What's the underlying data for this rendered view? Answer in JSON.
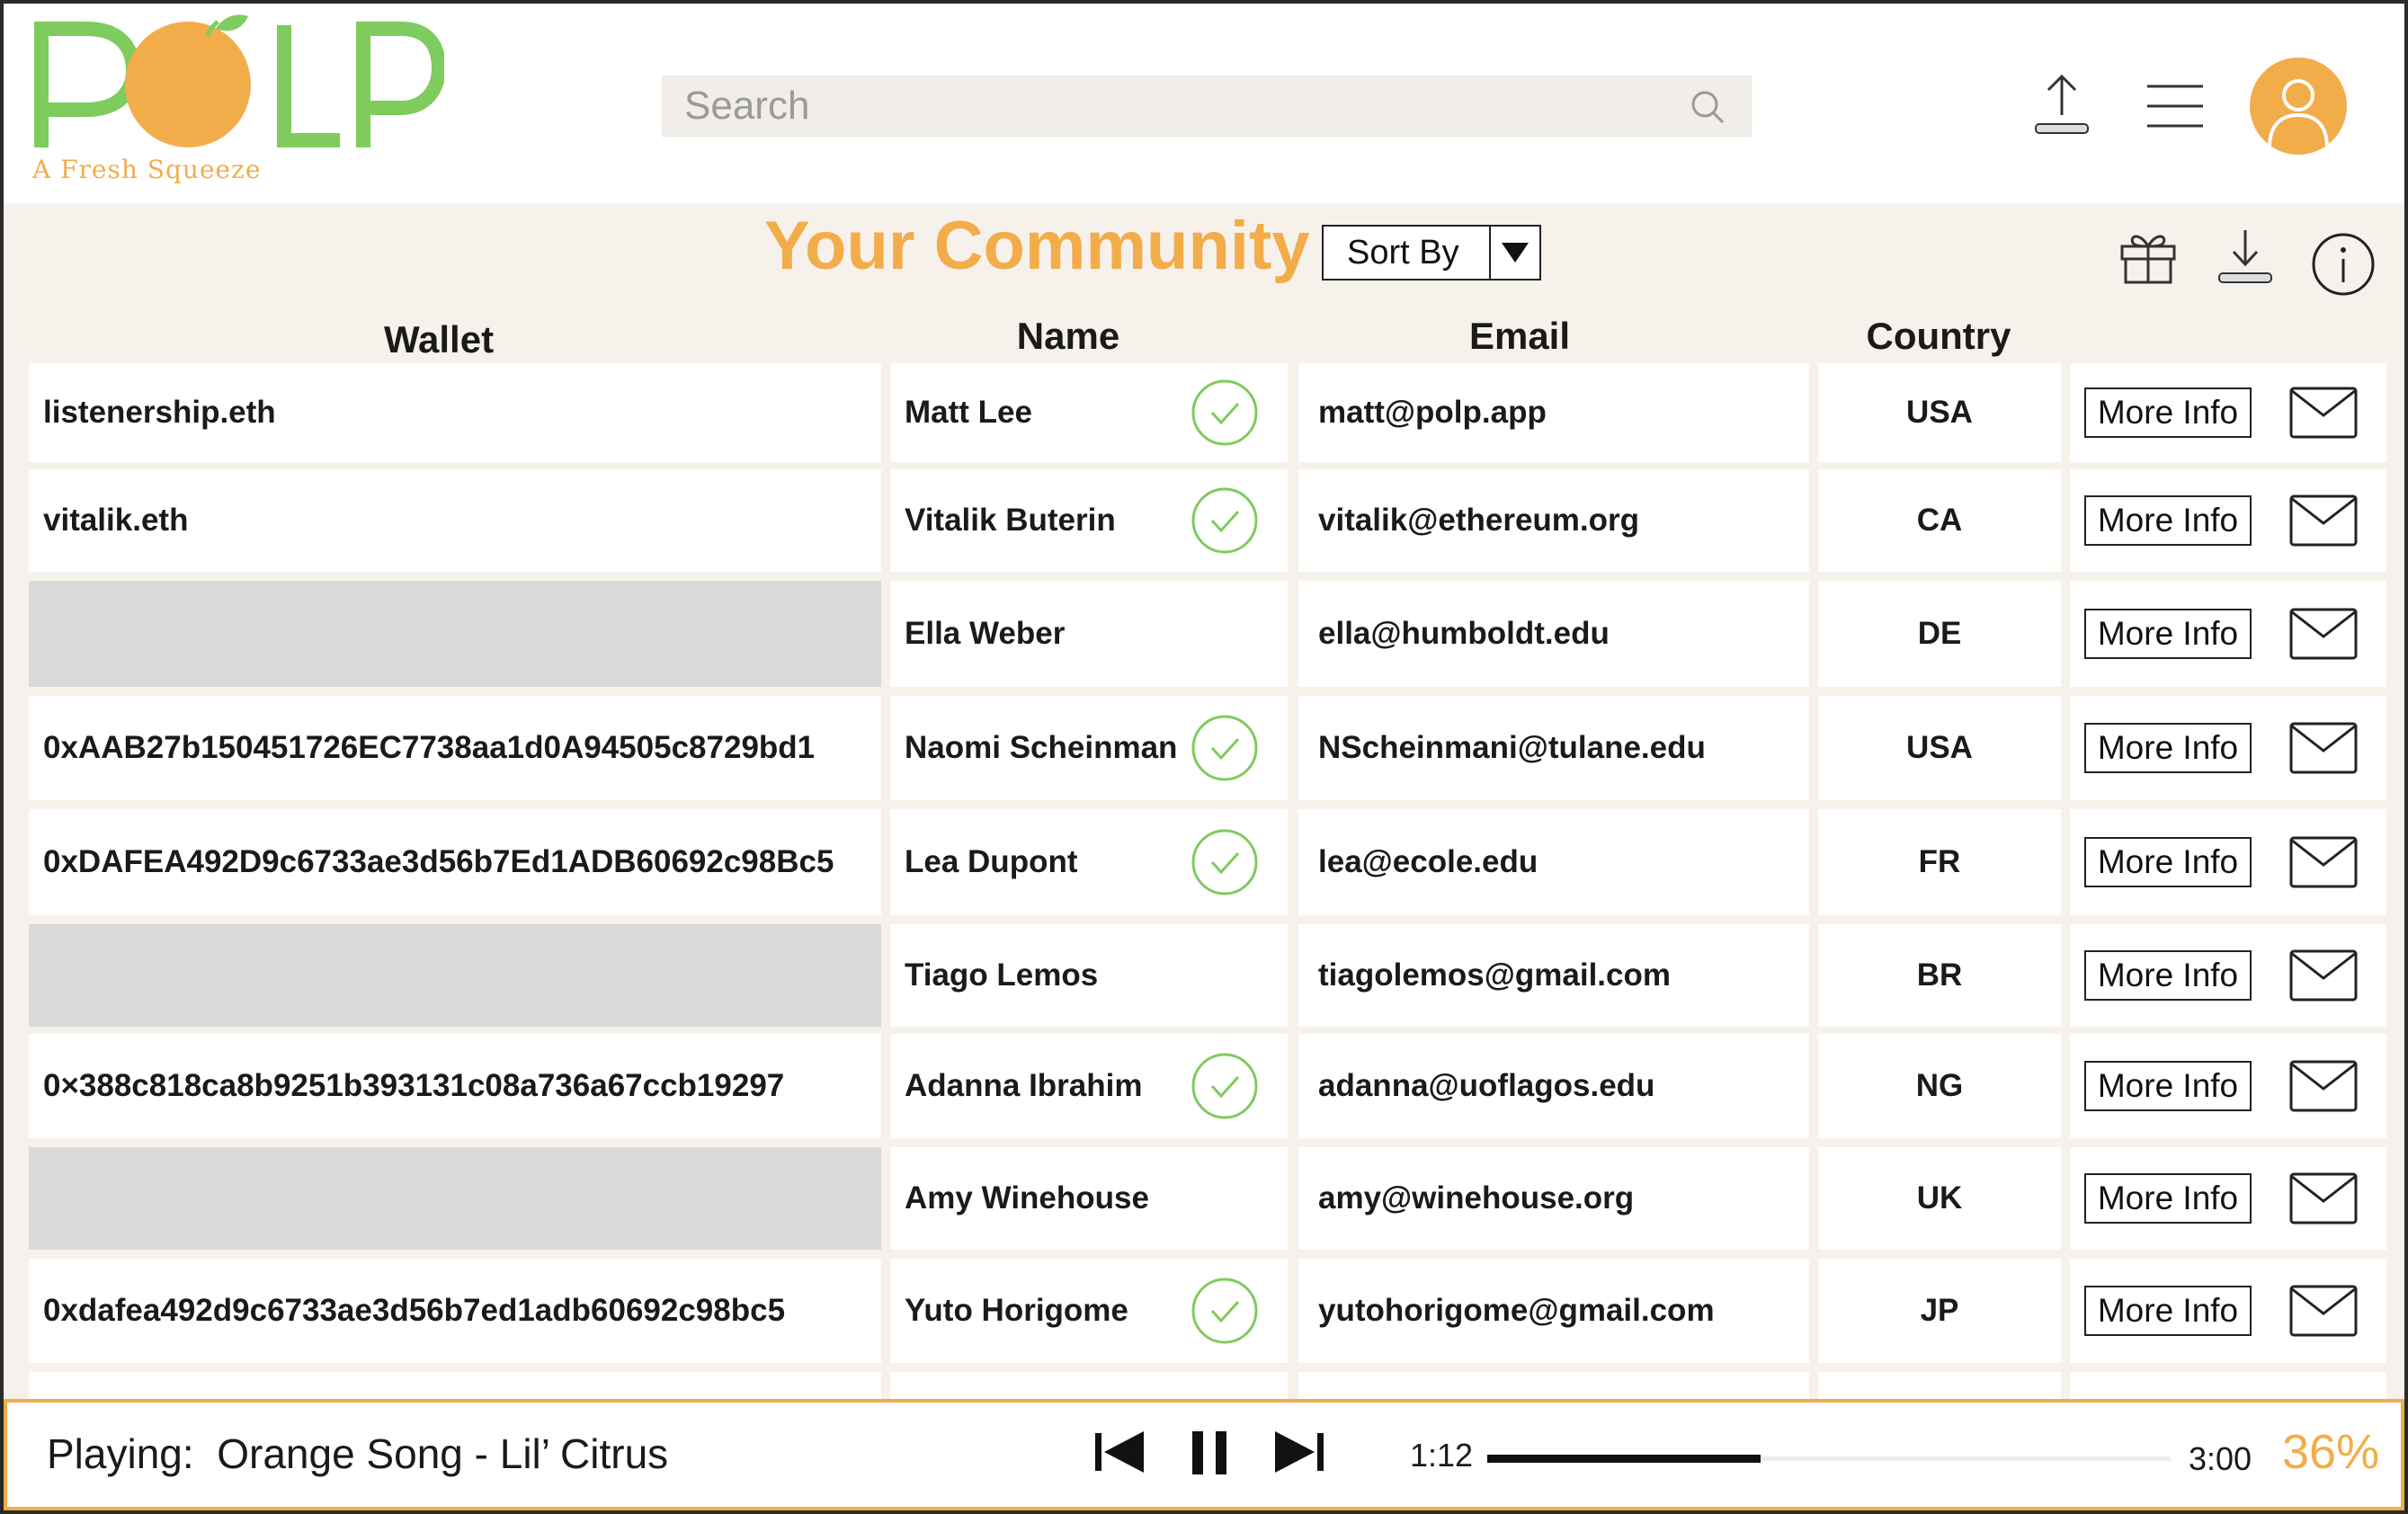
{
  "brand": {
    "name": "POLP",
    "tagline": "A Fresh Squeeze",
    "colors": {
      "orange": "#f2ad4a",
      "green": "#7ecb5e"
    }
  },
  "search": {
    "placeholder": "Search"
  },
  "header_icons": [
    "upload-icon",
    "hamburger-menu-icon",
    "user-avatar-icon"
  ],
  "community": {
    "title": "Your Community",
    "sort_label": "Sort By",
    "toolbar_icons": [
      "gift-icon",
      "download-icon",
      "info-icon"
    ]
  },
  "columns": {
    "wallet": "Wallet",
    "name": "Name",
    "email": "Email",
    "country": "Country"
  },
  "more_info_label": "More Info",
  "members": [
    {
      "wallet": "listenership.eth",
      "name": "Matt Lee",
      "verified": true,
      "email": "matt@polp.app",
      "country": "USA"
    },
    {
      "wallet": "vitalik.eth",
      "name": "Vitalik Buterin",
      "verified": true,
      "email": "vitalik@ethereum.org",
      "country": "CA"
    },
    {
      "wallet": "",
      "name": "Ella Weber",
      "verified": false,
      "email": "ella@humboldt.edu",
      "country": "DE"
    },
    {
      "wallet": "0xAAB27b150451726EC7738aa1d0A94505c8729bd1",
      "name": "Naomi Scheinman",
      "verified": true,
      "email": "NScheinmani@tulane.edu",
      "country": "USA"
    },
    {
      "wallet": "0xDAFEA492D9c6733ae3d56b7Ed1ADB60692c98Bc5",
      "name": "Lea Dupont",
      "verified": true,
      "email": "lea@ecole.edu",
      "country": "FR"
    },
    {
      "wallet": "",
      "name": "Tiago Lemos",
      "verified": false,
      "email": "tiagolemos@gmail.com",
      "country": "BR"
    },
    {
      "wallet": "0×388c818ca8b9251b393131c08a736a67ccb19297",
      "name": "Adanna Ibrahim",
      "verified": true,
      "email": "adanna@uoflagos.edu",
      "country": "NG"
    },
    {
      "wallet": "",
      "name": "Amy Winehouse",
      "verified": false,
      "email": "amy@winehouse.org",
      "country": "UK"
    },
    {
      "wallet": "0xdafea492d9c6733ae3d56b7ed1adb60692c98bc5",
      "name": "Yuto Horigome",
      "verified": true,
      "email": "yutohorigome@gmail.com",
      "country": "JP"
    },
    {
      "wallet": "",
      "name": "",
      "verified": false,
      "email": "",
      "country": ""
    }
  ],
  "player": {
    "label": "Playing:",
    "track": "Orange Song - Lil’ Citrus",
    "elapsed": "1:12",
    "duration": "3:00",
    "volume": "36%",
    "progress_fraction": 0.4
  }
}
